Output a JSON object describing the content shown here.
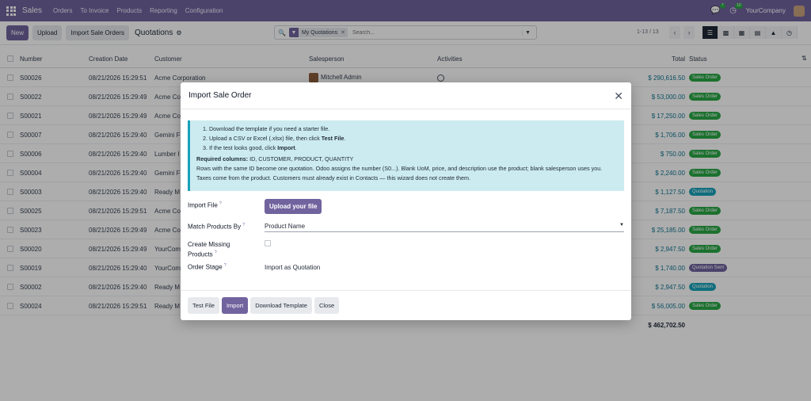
{
  "navbar": {
    "app_name": "Sales",
    "menu": [
      "Orders",
      "To Invoice",
      "Products",
      "Reporting",
      "Configuration"
    ],
    "messages_count": "7",
    "activities_count": "10",
    "company": "YourCompany"
  },
  "control_panel": {
    "new_label": "New",
    "upload_label": "Upload",
    "import_label": "Import Sale Orders",
    "title": "Quotations",
    "search": {
      "facet": "My Quotations",
      "placeholder": "Search..."
    },
    "pager": "1-13 / 13"
  },
  "table": {
    "headers": {
      "number": "Number",
      "date": "Creation Date",
      "customer": "Customer",
      "salesperson": "Salesperson",
      "activities": "Activities",
      "total": "Total",
      "status": "Status"
    },
    "rows": [
      {
        "number": "S00026",
        "date": "08/21/2026 15:29:51",
        "customer": "Acme Corporation",
        "salesperson": "Mitchell Admin",
        "total": "$ 290,616.50",
        "status": "Sales Order",
        "status_kind": "so"
      },
      {
        "number": "S00022",
        "date": "08/21/2026 15:29:49",
        "customer": "Acme Co",
        "salesperson": "",
        "total": "$ 53,000.00",
        "status": "Sales Order",
        "status_kind": "so"
      },
      {
        "number": "S00021",
        "date": "08/21/2026 15:29:49",
        "customer": "Acme Co",
        "salesperson": "",
        "total": "$ 17,250.00",
        "status": "Sales Order",
        "status_kind": "so"
      },
      {
        "number": "S00007",
        "date": "08/21/2026 15:29:40",
        "customer": "Gemini F",
        "salesperson": "",
        "total": "$ 1,706.00",
        "status": "Sales Order",
        "status_kind": "so"
      },
      {
        "number": "S00006",
        "date": "08/21/2026 15:29:40",
        "customer": "Lumber I",
        "salesperson": "",
        "total": "$ 750.00",
        "status": "Sales Order",
        "status_kind": "so"
      },
      {
        "number": "S00004",
        "date": "08/21/2026 15:29:40",
        "customer": "Gemini F",
        "salesperson": "",
        "total": "$ 2,240.00",
        "status": "Sales Order",
        "status_kind": "so"
      },
      {
        "number": "S00003",
        "date": "08/21/2026 15:29:40",
        "customer": "Ready M",
        "salesperson": "",
        "total": "$ 1,127.50",
        "status": "Quotation",
        "status_kind": "q"
      },
      {
        "number": "S00025",
        "date": "08/21/2026 15:29:51",
        "customer": "Acme Co",
        "salesperson": "",
        "total": "$ 7,187.50",
        "status": "Sales Order",
        "status_kind": "so"
      },
      {
        "number": "S00023",
        "date": "08/21/2026 15:29:49",
        "customer": "Acme Co",
        "salesperson": "",
        "total": "$ 25,185.00",
        "status": "Sales Order",
        "status_kind": "so"
      },
      {
        "number": "S00020",
        "date": "08/21/2026 15:29:49",
        "customer": "YourCom",
        "salesperson": "",
        "total": "$ 2,947.50",
        "status": "Sales Order",
        "status_kind": "so"
      },
      {
        "number": "S00019",
        "date": "08/21/2026 15:29:40",
        "customer": "YourCom",
        "salesperson": "",
        "total": "$ 1,740.00",
        "status": "Quotation Sent",
        "status_kind": "qs"
      },
      {
        "number": "S00002",
        "date": "08/21/2026 15:29:40",
        "customer": "Ready M",
        "salesperson": "",
        "total": "$ 2,947.50",
        "status": "Quotation",
        "status_kind": "q"
      },
      {
        "number": "S00024",
        "date": "08/21/2026 15:29:51",
        "customer": "Ready M",
        "salesperson": "",
        "total": "$ 56,005.00",
        "status": "Sales Order",
        "status_kind": "so"
      }
    ],
    "grand_total": "$ 462,702.50"
  },
  "modal": {
    "title": "Import Sale Order",
    "steps": [
      "1. Download the template if you need a starter file.",
      "2. Upload a CSV or Excel (.xlsx) file, then click ",
      "3. If the test looks good, click "
    ],
    "step2_bold": "Test File",
    "step2_end": ".",
    "step3_bold": "Import",
    "step3_end": ".",
    "required_label": "Required columns:",
    "required_value": " ID, CUSTOMER, PRODUCT, QUANTITY",
    "note": "Rows with the same ID become one quotation. Odoo assigns the number (S0...). Blank UoM, price, and description use the product; blank salesperson uses you. Taxes come from the product. Customers must already exist in Contacts — this wizard does not create them.",
    "import_file_label": "Import File",
    "upload_button": "Upload your file",
    "match_label": "Match Products By",
    "match_value": "Product Name",
    "create_missing_label": "Create Missing Products",
    "order_stage_label": "Order Stage",
    "order_stage_value": "Import as Quotation",
    "help_mark": "?",
    "footer": {
      "test": "Test File",
      "import": "Import",
      "download": "Download Template",
      "close": "Close"
    }
  }
}
